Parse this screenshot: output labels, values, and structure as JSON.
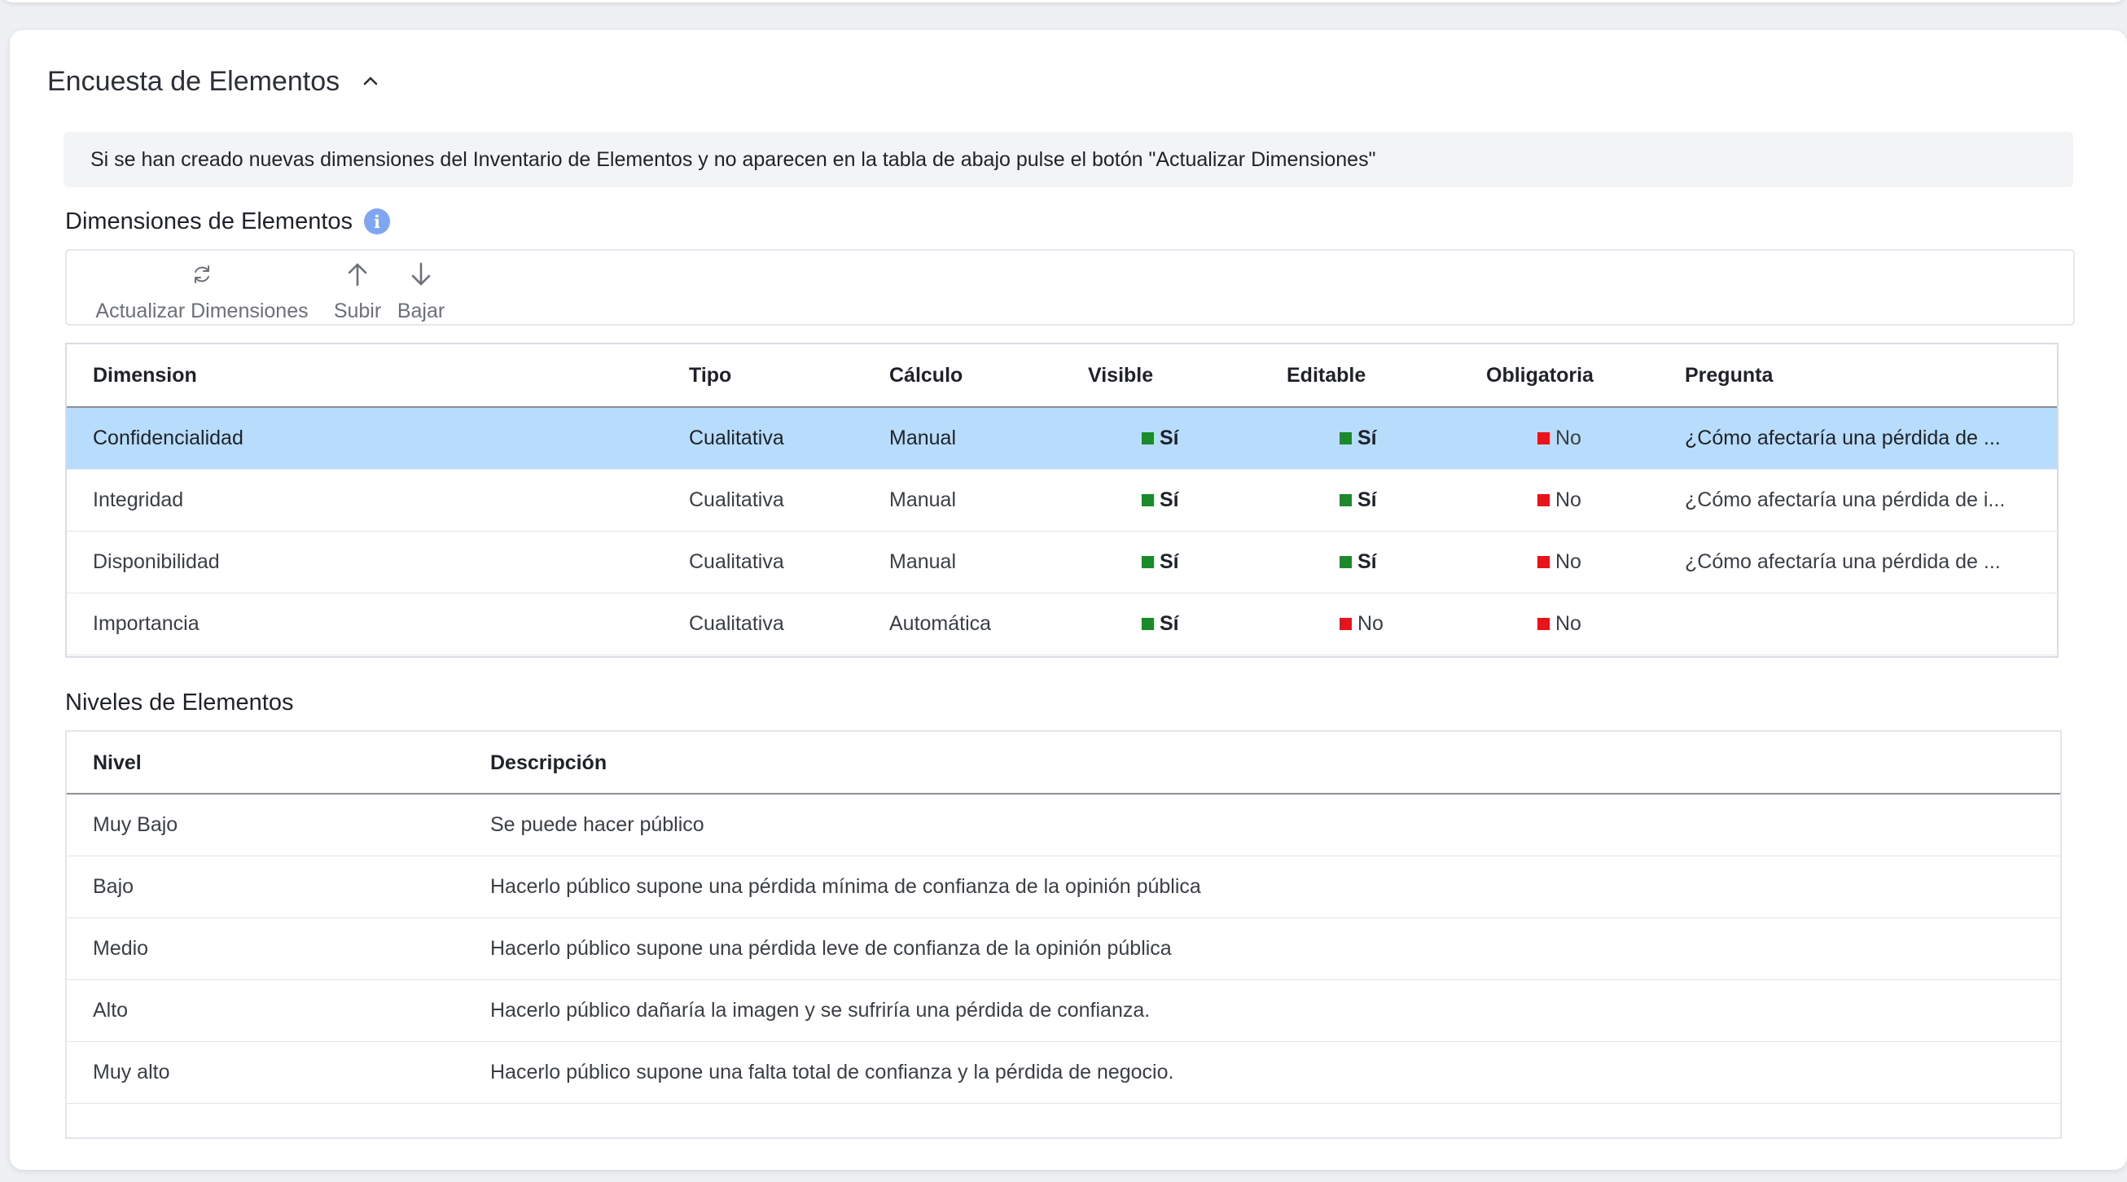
{
  "section": {
    "title": "Encuesta de Elementos"
  },
  "banner": {
    "text": "Si se han creado nuevas dimensiones del Inventario de Elementos y no aparecen en la tabla de abajo pulse el botón \"Actualizar Dimensiones\""
  },
  "dimensions": {
    "title": "Dimensiones de Elementos",
    "info_glyph": "i",
    "toolbar": {
      "refresh_label": "Actualizar Dimensiones",
      "up_label": "Subir",
      "down_label": "Bajar"
    },
    "columns": [
      "Dimension",
      "Tipo",
      "Cálculo",
      "Visible",
      "Editable",
      "Obligatoria",
      "Pregunta"
    ],
    "rows": [
      {
        "dimension": "Confidencialidad",
        "tipo": "Cualitativa",
        "calculo": "Manual",
        "visible": "Sí",
        "editable": "Sí",
        "obligatoria": "No",
        "pregunta": "¿Cómo afectaría una pérdida de ...",
        "selected": true
      },
      {
        "dimension": "Integridad",
        "tipo": "Cualitativa",
        "calculo": "Manual",
        "visible": "Sí",
        "editable": "Sí",
        "obligatoria": "No",
        "pregunta": "¿Cómo afectaría una pérdida de i...",
        "selected": false
      },
      {
        "dimension": "Disponibilidad",
        "tipo": "Cualitativa",
        "calculo": "Manual",
        "visible": "Sí",
        "editable": "Sí",
        "obligatoria": "No",
        "pregunta": "¿Cómo afectaría una pérdida de ...",
        "selected": false
      },
      {
        "dimension": "Importancia",
        "tipo": "Cualitativa",
        "calculo": "Automática",
        "visible": "Sí",
        "editable": "No",
        "obligatoria": "No",
        "pregunta": "",
        "selected": false
      }
    ]
  },
  "levels": {
    "title": "Niveles de Elementos",
    "columns": [
      "Nivel",
      "Descripción"
    ],
    "rows": [
      {
        "nivel": "Muy Bajo",
        "descripcion": "Se puede hacer público"
      },
      {
        "nivel": "Bajo",
        "descripcion": "Hacerlo público supone una pérdida mínima de confianza de la opinión pública"
      },
      {
        "nivel": "Medio",
        "descripcion": "Hacerlo público supone una pérdida leve de confianza de la opinión pública"
      },
      {
        "nivel": "Alto",
        "descripcion": "Hacerlo público dañaría la imagen y se sufriría una pérdida de confianza."
      },
      {
        "nivel": "Muy alto",
        "descripcion": "Hacerlo público supone una falta total de confianza y la pérdida de negocio."
      }
    ]
  },
  "colors": {
    "selected_row": "#b8dcfb",
    "yes_indicator": "#1a8a2a",
    "no_indicator": "#e8141c",
    "info_icon": "#7ea6f2"
  },
  "icons": {
    "section_toggle": "chevron-up-icon",
    "info": "info-icon",
    "refresh": "refresh-icon",
    "up": "arrow-up-icon",
    "down": "arrow-down-icon"
  }
}
